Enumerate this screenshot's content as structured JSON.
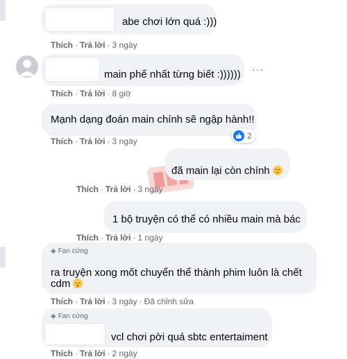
{
  "comments": [
    {
      "text": "abe chơi lớn quá :)))",
      "like": "Thích",
      "reply": "Trả lời",
      "time": "3 ngày"
    },
    {
      "text": "main phế nhất từng biết :))))))",
      "like": "Thích",
      "reply": "Trả lời",
      "time": "8 giờ"
    },
    {
      "text": "Mạnh dạng đoán main chính sẽ ngập hành!!",
      "like": "Thích",
      "reply": "Trả lời",
      "time": "3 ngày",
      "reaction_count": "2"
    },
    {
      "text": "đã main lại còn chính",
      "like": "Thích",
      "reply": "Trả lời",
      "time": "3 ngày"
    },
    {
      "text": "1 bộ truyện có thể có nhiều main mà bác",
      "like": "Thích",
      "reply": "Trả lời",
      "time": "1 ngày"
    },
    {
      "badge": "Fan cứng",
      "line1": "ra truyện xong mốt chuyển thể thành phim luôn là chết",
      "line2": "cdm",
      "like": "Thích",
      "reply": "Trả lời",
      "time": "3 ngày",
      "edited": "Đã chỉnh sửa"
    },
    {
      "badge": "Fan cứng",
      "text": "vcl chơi pời quá sbtc entertaiment",
      "like": "Thích",
      "reply": "Trả lời",
      "time": "2 ngày"
    }
  ],
  "more_options": "···",
  "watermark": "logo",
  "colors": {
    "bubble": "#f0f2f5",
    "meta": "#65676b",
    "like_blue": "#1877f2"
  }
}
